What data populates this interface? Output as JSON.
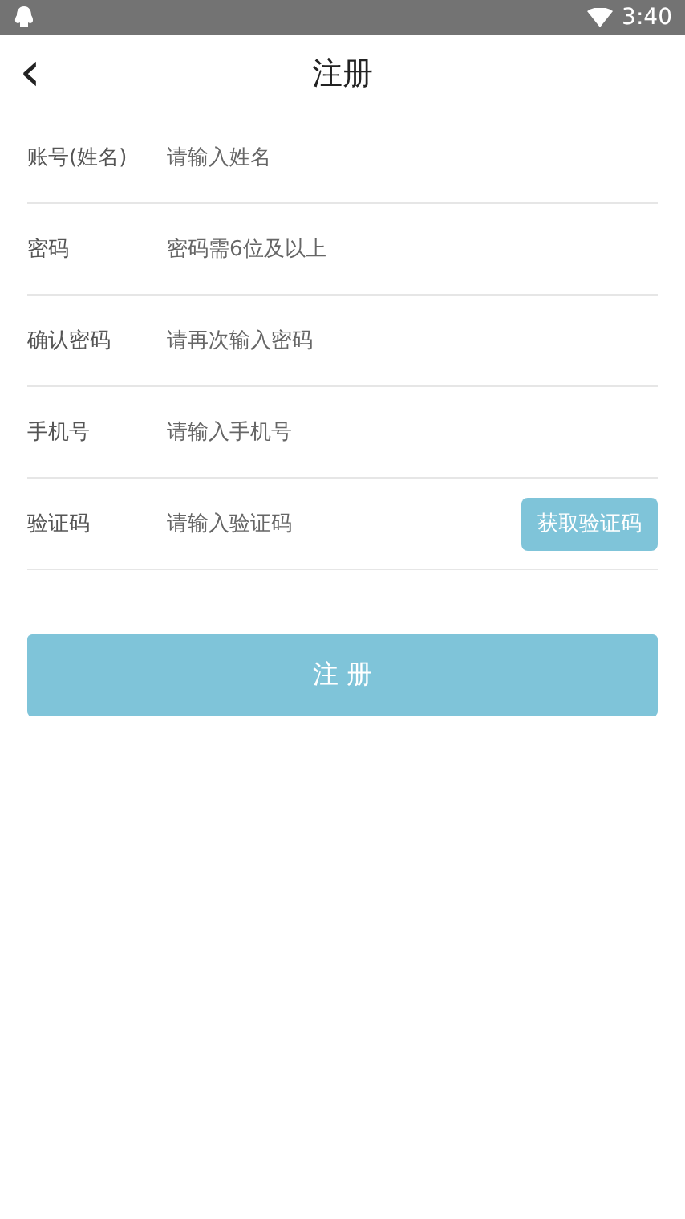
{
  "status_bar": {
    "time": "3:40"
  },
  "header": {
    "back": "‹",
    "title": "注册"
  },
  "fields": [
    {
      "label": "账号(姓名)",
      "placeholder": "请输入姓名",
      "kind": "text"
    },
    {
      "label": "密码",
      "placeholder": "密码需6位及以上",
      "kind": "text"
    },
    {
      "label": "确认密码",
      "placeholder": "请再次输入密码",
      "kind": "text"
    },
    {
      "label": "手机号",
      "placeholder": "请输入手机号",
      "kind": "text"
    },
    {
      "label": "验证码",
      "placeholder": "请输入验证码",
      "kind": "code",
      "button": "获取验证码"
    }
  ],
  "submit": "注 册"
}
